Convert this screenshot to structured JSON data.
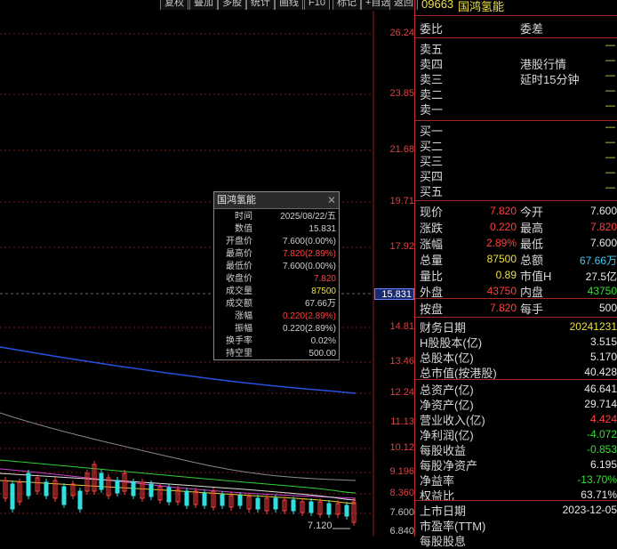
{
  "toolbar": {
    "buttons": [
      "复权",
      "叠加",
      "多股",
      "统计",
      "画线",
      "F10",
      "标记",
      "+自选",
      "返回"
    ]
  },
  "stock": {
    "code": "09663",
    "name": "国鸿氢能"
  },
  "yaxis": {
    "ticks": [
      "26.24",
      "23.85",
      "21.68",
      "19.71",
      "17.92",
      "14.81",
      "13.46",
      "12.24",
      "11.13",
      "10.12",
      "9.196",
      "8.360",
      "7.600",
      "6.840"
    ],
    "current_price": "15.831"
  },
  "chart_data": {
    "type": "candlestick",
    "annotations": [
      "7.120"
    ]
  },
  "tooltip": {
    "title": "国鸿氢能",
    "rows": [
      {
        "k": "时间",
        "v": "2025/08/22/五",
        "c": ""
      },
      {
        "k": "数值",
        "v": "15.831",
        "c": ""
      },
      {
        "k": "开盘价",
        "v": "7.600(0.00%)",
        "c": ""
      },
      {
        "k": "最高价",
        "v": "7.820(2.89%)",
        "c": "red"
      },
      {
        "k": "最低价",
        "v": "7.600(0.00%)",
        "c": ""
      },
      {
        "k": "收盘价",
        "v": "7.820",
        "c": "red"
      },
      {
        "k": "成交量",
        "v": "87500",
        "c": "yel"
      },
      {
        "k": "成交额",
        "v": "67.66万",
        "c": ""
      },
      {
        "k": "涨幅",
        "v": "0.220(2.89%)",
        "c": "red"
      },
      {
        "k": "振幅",
        "v": "0.220(2.89%)",
        "c": ""
      },
      {
        "k": "换手率",
        "v": "0.02%",
        "c": ""
      },
      {
        "k": "持空里",
        "v": "500.00",
        "c": ""
      }
    ]
  },
  "panel": {
    "weibi": "委比",
    "weicha": "委差",
    "sells": [
      "卖五",
      "卖四",
      "卖三",
      "卖二",
      "卖一"
    ],
    "buys": [
      "买一",
      "买二",
      "买三",
      "买四",
      "买五"
    ],
    "dash": "—",
    "notice1": "港股行情",
    "notice2": "延时15分钟",
    "quote": [
      {
        "l1": "现价",
        "v1": "7.820",
        "c1": "red",
        "l2": "今开",
        "v2": "7.600",
        "c2": "wht"
      },
      {
        "l1": "涨跌",
        "v1": "0.220",
        "c1": "red",
        "l2": "最高",
        "v2": "7.820",
        "c2": "red"
      },
      {
        "l1": "涨幅",
        "v1": "2.89%",
        "c1": "red",
        "l2": "最低",
        "v2": "7.600",
        "c2": "wht"
      },
      {
        "l1": "总量",
        "v1": "87500",
        "c1": "yel",
        "l2": "总额",
        "v2": "67.66万",
        "c2": "cyn"
      },
      {
        "l1": "量比",
        "v1": "0.89",
        "c1": "yel",
        "l2": "市值H",
        "v2": "27.5亿",
        "c2": "wht"
      },
      {
        "l1": "外盘",
        "v1": "43750",
        "c1": "red",
        "l2": "内盘",
        "v2": "43750",
        "c2": "grn"
      }
    ],
    "jupan": {
      "l1": "按盘",
      "v1": "7.820",
      "c1": "red",
      "l2": "每手",
      "v2": "500",
      "c2": "wht"
    },
    "fin1": [
      {
        "k": "财务日期",
        "v": "20241231",
        "c": "yel"
      },
      {
        "k": "H股股本(亿)",
        "v": "3.515",
        "c": "wht"
      },
      {
        "k": "总股本(亿)",
        "v": "5.170",
        "c": "wht"
      },
      {
        "k": "总市值(按港股)",
        "v": "40.428",
        "c": "wht"
      }
    ],
    "fin2": [
      {
        "k": "总资产(亿)",
        "v": "46.641",
        "c": "wht"
      },
      {
        "k": "净资产(亿)",
        "v": "29.714",
        "c": "wht"
      },
      {
        "k": "营业收入(亿)",
        "v": "4.424",
        "c": "red"
      },
      {
        "k": "净利润(亿)",
        "v": "-4.072",
        "c": "grn"
      },
      {
        "k": "每股收益",
        "v": "-0.853",
        "c": "grn"
      },
      {
        "k": "每股净资产",
        "v": "6.195",
        "c": "wht"
      },
      {
        "k": "净益率",
        "v": "-13.70%",
        "c": "grn"
      },
      {
        "k": "权益比",
        "v": "63.71%",
        "c": "wht"
      }
    ],
    "fin3": [
      {
        "k": "上市日期",
        "v": "2023-12-05",
        "c": "wht"
      },
      {
        "k": "市盈率(TTM)",
        "v": "",
        "c": "wht"
      },
      {
        "k": "每股股息",
        "v": "",
        "c": "wht"
      }
    ]
  }
}
